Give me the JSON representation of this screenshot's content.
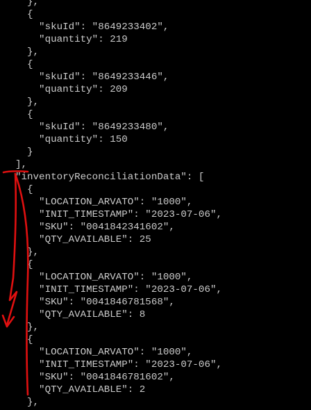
{
  "colors": {
    "background": "#000000",
    "text": "#cccccc",
    "annotation": "#e01010"
  },
  "lines": [
    "  },",
    "  {",
    "    \"skuId\": \"8649233402\",",
    "    \"quantity\": 219",
    "  },",
    "  {",
    "    \"skuId\": \"8649233446\",",
    "    \"quantity\": 209",
    "  },",
    "  {",
    "    \"skuId\": \"8649233480\",",
    "    \"quantity\": 150",
    "  }",
    "],",
    "\"inventoryReconciliationData\": [",
    "  {",
    "    \"LOCATION_ARVATO\": \"1000\",",
    "    \"INIT_TIMESTAMP\": \"2023-07-06\",",
    "    \"SKU\": \"0041842341602\",",
    "    \"QTY_AVAILABLE\": 25",
    "  },",
    "  {",
    "    \"LOCATION_ARVATO\": \"1000\",",
    "    \"INIT_TIMESTAMP\": \"2023-07-06\",",
    "    \"SKU\": \"0041846781568\",",
    "    \"QTY_AVAILABLE\": 8",
    "  },",
    "  {",
    "    \"LOCATION_ARVATO\": \"1000\",",
    "    \"INIT_TIMESTAMP\": \"2023-07-06\",",
    "    \"SKU\": \"0041846781602\",",
    "    \"QTY_AVAILABLE\": 2",
    "  },"
  ]
}
